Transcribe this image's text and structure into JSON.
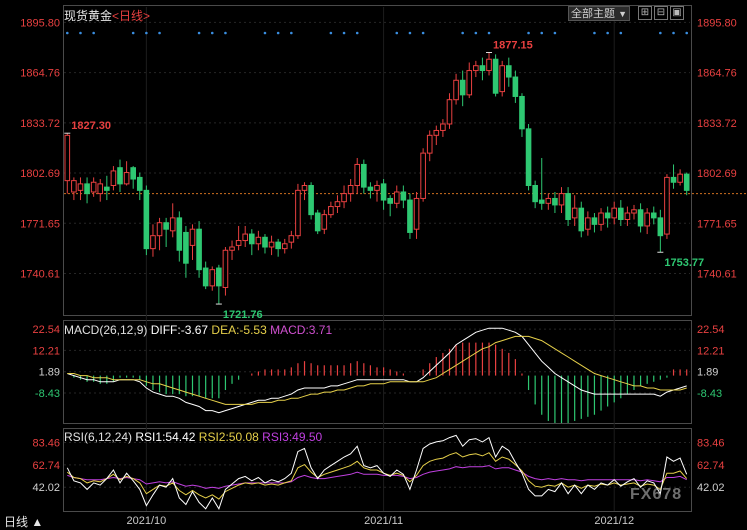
{
  "header": {
    "title": "现货黄金",
    "period": "<日线>",
    "theme_label": "全部主题",
    "dropdown_arrow": "▼"
  },
  "window_controls": [
    "square-grid-icon",
    "split-icon",
    "restore-icon"
  ],
  "footer": {
    "period_label": "日线 ▲"
  },
  "watermark": "FX678",
  "colors": {
    "up": "#e84040",
    "down": "#2ec872",
    "diff": "#ffffff",
    "dea": "#e6d04a",
    "macd": "#d050d0",
    "rsi1": "#ffffff",
    "rsi2": "#e6d04a",
    "rsi3": "#c040e0",
    "current_line": "#d07020",
    "axis_text": "#e84040",
    "axis_mid": "#d0d0d0"
  },
  "chart_data": [
    {
      "type": "candlestick",
      "title": "现货黄金 <日线>",
      "y_ticks": [
        "1895.80",
        "1864.76",
        "1833.72",
        "1802.69",
        "1771.65",
        "1740.61"
      ],
      "ylim": [
        1715,
        1896
      ],
      "x_ticks": [
        "2021/10",
        "2021/11",
        "2021/12"
      ],
      "current_price": 1790,
      "annotations": [
        {
          "label": "1827.30",
          "value": 1827.3,
          "kind": "high"
        },
        {
          "label": "1877.15",
          "value": 1877.15,
          "kind": "high"
        },
        {
          "label": "1721.76",
          "value": 1721.76,
          "kind": "low"
        },
        {
          "label": "1753.77",
          "value": 1753.77,
          "kind": "low"
        }
      ],
      "candles": [
        [
          1798,
          1826,
          1790,
          1827.3
        ],
        [
          1791,
          1798,
          1786,
          1800
        ],
        [
          1792,
          1796,
          1786,
          1800
        ],
        [
          1796,
          1790,
          1784,
          1800
        ],
        [
          1791,
          1797,
          1788,
          1800
        ],
        [
          1790,
          1796,
          1785,
          1799
        ],
        [
          1794,
          1792,
          1786,
          1801
        ],
        [
          1795,
          1804,
          1792,
          1807
        ],
        [
          1806,
          1796,
          1791,
          1811
        ],
        [
          1796,
          1803,
          1795,
          1810
        ],
        [
          1806,
          1799,
          1793,
          1807
        ],
        [
          1800,
          1792,
          1786,
          1803
        ],
        [
          1792,
          1756,
          1752,
          1795
        ],
        [
          1756,
          1764,
          1751,
          1771
        ],
        [
          1764,
          1772,
          1755,
          1775
        ],
        [
          1772,
          1768,
          1757,
          1775
        ],
        [
          1767,
          1775,
          1763,
          1784
        ],
        [
          1775,
          1755,
          1748,
          1779
        ],
        [
          1766,
          1747,
          1738,
          1770
        ],
        [
          1758,
          1768,
          1749,
          1771
        ],
        [
          1768,
          1743,
          1738,
          1773
        ],
        [
          1744,
          1733,
          1731,
          1748
        ],
        [
          1733,
          1743,
          1730,
          1745
        ],
        [
          1744,
          1733,
          1721.76,
          1746
        ],
        [
          1732,
          1755,
          1727,
          1757
        ],
        [
          1755,
          1757,
          1749,
          1761
        ],
        [
          1758,
          1761,
          1755,
          1770
        ],
        [
          1761,
          1765,
          1757,
          1770
        ],
        [
          1765,
          1759,
          1752,
          1768
        ],
        [
          1759,
          1763,
          1755,
          1767
        ],
        [
          1763,
          1757,
          1753,
          1765
        ],
        [
          1757,
          1760,
          1752,
          1764
        ],
        [
          1760,
          1756,
          1751,
          1762
        ],
        [
          1756,
          1759,
          1753,
          1762
        ],
        [
          1760,
          1764,
          1756,
          1767
        ],
        [
          1764,
          1792,
          1762,
          1796
        ],
        [
          1792,
          1795,
          1786,
          1797
        ],
        [
          1795,
          1777,
          1774,
          1797
        ],
        [
          1778,
          1767,
          1765,
          1780
        ],
        [
          1768,
          1777,
          1765,
          1780
        ],
        [
          1777,
          1782,
          1775,
          1785
        ],
        [
          1782,
          1785,
          1778,
          1789
        ],
        [
          1785,
          1790,
          1781,
          1795
        ],
        [
          1790,
          1795,
          1785,
          1799
        ],
        [
          1795,
          1808,
          1790,
          1812
        ],
        [
          1808,
          1794,
          1790,
          1811
        ],
        [
          1794,
          1792,
          1787,
          1797
        ],
        [
          1792,
          1795,
          1785,
          1798
        ],
        [
          1796,
          1786,
          1780,
          1799
        ],
        [
          1787,
          1784,
          1776,
          1789
        ],
        [
          1784,
          1791,
          1781,
          1795
        ],
        [
          1791,
          1786,
          1781,
          1795
        ],
        [
          1786,
          1766,
          1762,
          1790
        ],
        [
          1768,
          1787,
          1762,
          1791
        ],
        [
          1787,
          1815,
          1785,
          1818
        ],
        [
          1815,
          1826,
          1810,
          1829
        ],
        [
          1826,
          1829,
          1820,
          1832
        ],
        [
          1829,
          1833,
          1825,
          1836
        ],
        [
          1833,
          1848,
          1830,
          1852
        ],
        [
          1848,
          1860,
          1845,
          1864
        ],
        [
          1860,
          1851,
          1844,
          1866
        ],
        [
          1851,
          1866,
          1849,
          1871
        ],
        [
          1866,
          1869,
          1862,
          1872
        ],
        [
          1869,
          1866,
          1860,
          1874
        ],
        [
          1866,
          1873,
          1863,
          1877.15
        ],
        [
          1873,
          1852,
          1850,
          1876
        ],
        [
          1853,
          1869,
          1850,
          1872
        ],
        [
          1869,
          1862,
          1856,
          1874
        ],
        [
          1862,
          1850,
          1846,
          1866
        ],
        [
          1850,
          1830,
          1825,
          1852
        ],
        [
          1830,
          1795,
          1792,
          1833
        ],
        [
          1795,
          1785,
          1781,
          1798
        ],
        [
          1786,
          1784,
          1780,
          1812
        ],
        [
          1784,
          1787,
          1780,
          1790
        ],
        [
          1787,
          1783,
          1778,
          1791
        ],
        [
          1783,
          1790,
          1778,
          1794
        ],
        [
          1790,
          1774,
          1770,
          1794
        ],
        [
          1775,
          1781,
          1770,
          1789
        ],
        [
          1781,
          1767,
          1763,
          1785
        ],
        [
          1768,
          1775,
          1764,
          1779
        ],
        [
          1775,
          1771,
          1766,
          1778
        ],
        [
          1771,
          1778,
          1767,
          1781
        ],
        [
          1778,
          1775,
          1769,
          1782
        ],
        [
          1775,
          1781,
          1771,
          1785
        ],
        [
          1781,
          1774,
          1770,
          1786
        ],
        [
          1774,
          1778,
          1770,
          1782
        ],
        [
          1778,
          1780,
          1774,
          1783
        ],
        [
          1780,
          1770,
          1766,
          1784
        ],
        [
          1770,
          1778,
          1765,
          1781
        ],
        [
          1778,
          1775,
          1771,
          1782
        ],
        [
          1775,
          1764,
          1753.77,
          1780
        ],
        [
          1765,
          1800,
          1762,
          1802
        ],
        [
          1800,
          1797,
          1793,
          1808
        ],
        [
          1797,
          1802,
          1795,
          1805
        ],
        [
          1802,
          1792,
          1789,
          1803
        ]
      ]
    },
    {
      "type": "bar+line",
      "title": "MACD(26,12,9)",
      "indicator_labels": {
        "name": "MACD(26,12,9)",
        "diff": "DIFF:-3.67",
        "dea": "DEA:-5.53",
        "macd": "MACD:3.71"
      },
      "y_ticks": [
        "22.54",
        "12.21",
        "1.89",
        "-8.43"
      ],
      "ylim": [
        -23,
        26
      ],
      "series": [
        {
          "name": "DIFF",
          "values": [
            1,
            0,
            -1,
            -2,
            -2,
            -3,
            -3,
            -3,
            -2,
            -2,
            -2,
            -3,
            -6,
            -8,
            -9,
            -10,
            -10,
            -11,
            -13,
            -14,
            -15,
            -17,
            -17,
            -18,
            -17,
            -16,
            -15,
            -14,
            -13,
            -12,
            -12,
            -11,
            -11,
            -10,
            -9,
            -7,
            -6,
            -6,
            -6,
            -6,
            -5,
            -5,
            -4,
            -3,
            -2,
            -2,
            -2,
            -2,
            -2,
            -2,
            -2,
            -2,
            -3,
            -3,
            -1,
            2,
            5,
            8,
            11,
            15,
            17,
            19,
            21,
            22,
            23,
            23,
            23,
            22,
            21,
            19,
            15,
            11,
            7,
            4,
            1,
            -1,
            -3,
            -5,
            -7,
            -8,
            -9,
            -9,
            -9,
            -9,
            -9,
            -9,
            -9,
            -9,
            -9,
            -9,
            -10,
            -8,
            -7,
            -6,
            -5
          ]
        },
        {
          "name": "DEA",
          "values": [
            1,
            1,
            0,
            0,
            -1,
            -1,
            -1,
            -2,
            -2,
            -2,
            -2,
            -2,
            -3,
            -4,
            -4,
            -5,
            -6,
            -7,
            -8,
            -9,
            -10,
            -11,
            -12,
            -13,
            -14,
            -14,
            -14,
            -14,
            -14,
            -13,
            -13,
            -13,
            -12,
            -12,
            -11,
            -11,
            -10,
            -9,
            -9,
            -8,
            -8,
            -7,
            -7,
            -6,
            -5,
            -5,
            -4,
            -4,
            -4,
            -3,
            -3,
            -3,
            -3,
            -3,
            -3,
            -2,
            -1,
            1,
            3,
            5,
            7,
            9,
            11,
            13,
            14,
            16,
            17,
            18,
            19,
            19,
            19,
            18,
            17,
            15,
            13,
            11,
            9,
            7,
            5,
            3,
            1,
            0,
            -1,
            -2,
            -3,
            -4,
            -5,
            -5,
            -6,
            -6,
            -7,
            -7,
            -7,
            -7,
            -6
          ]
        },
        {
          "name": "MACD",
          "values": [
            0,
            -1,
            -2,
            -3,
            -3,
            -4,
            -4,
            -3,
            -1,
            -1,
            -1,
            -2,
            -5,
            -7,
            -8,
            -9,
            -9,
            -9,
            -10,
            -10,
            -10,
            -11,
            -11,
            -11,
            -7,
            -4,
            -2,
            0,
            1,
            2,
            3,
            3,
            3,
            3,
            4,
            6,
            7,
            6,
            5,
            5,
            5,
            5,
            5,
            6,
            7,
            6,
            5,
            4,
            4,
            3,
            2,
            1,
            0,
            0,
            3,
            6,
            9,
            11,
            13,
            15,
            16,
            16,
            16,
            16,
            16,
            15,
            13,
            11,
            8,
            1,
            -7,
            -14,
            -19,
            -22,
            -23,
            -23,
            -23,
            -22,
            -21,
            -20,
            -19,
            -17,
            -15,
            -13,
            -11,
            -9,
            -7,
            -5,
            -4,
            -3,
            -2,
            -1,
            3,
            3,
            3
          ]
        }
      ]
    },
    {
      "type": "line",
      "title": "RSI(6,12,24)",
      "indicator_labels": {
        "name": "RSI(6,12,24)",
        "rsi1": "RSI1:54.42",
        "rsi2": "RSI2:50.08",
        "rsi3": "RSI3:49.50"
      },
      "y_ticks": [
        "83.46",
        "62.74",
        "42.02"
      ],
      "ylim": [
        20,
        95
      ],
      "series": [
        {
          "name": "RSI1",
          "values": [
            60,
            48,
            46,
            40,
            46,
            44,
            50,
            58,
            46,
            55,
            48,
            40,
            25,
            35,
            44,
            42,
            50,
            32,
            26,
            38,
            28,
            22,
            32,
            22,
            40,
            45,
            50,
            52,
            48,
            51,
            46,
            49,
            47,
            50,
            55,
            75,
            78,
            60,
            50,
            58,
            62,
            66,
            70,
            73,
            80,
            62,
            60,
            62,
            55,
            52,
            58,
            54,
            40,
            58,
            78,
            82,
            84,
            85,
            88,
            90,
            80,
            86,
            87,
            84,
            88,
            70,
            80,
            76,
            65,
            55,
            40,
            34,
            34,
            40,
            38,
            46,
            36,
            44,
            36,
            44,
            40,
            46,
            44,
            49,
            43,
            47,
            50,
            42,
            48,
            46,
            36,
            70,
            66,
            69,
            54
          ]
        },
        {
          "name": "RSI2",
          "values": [
            56,
            51,
            50,
            46,
            48,
            47,
            50,
            54,
            49,
            52,
            50,
            46,
            36,
            40,
            44,
            43,
            46,
            39,
            35,
            39,
            35,
            32,
            35,
            31,
            38,
            41,
            44,
            46,
            45,
            46,
            44,
            45,
            44,
            46,
            48,
            60,
            63,
            56,
            51,
            54,
            56,
            58,
            60,
            62,
            66,
            60,
            58,
            58,
            55,
            53,
            55,
            53,
            47,
            53,
            62,
            66,
            68,
            69,
            72,
            74,
            70,
            72,
            73,
            71,
            74,
            66,
            70,
            68,
            63,
            57,
            48,
            43,
            42,
            44,
            43,
            46,
            42,
            44,
            41,
            44,
            43,
            45,
            44,
            46,
            44,
            45,
            46,
            43,
            45,
            44,
            40,
            55,
            55,
            57,
            50
          ]
        },
        {
          "name": "RSI3",
          "values": [
            53,
            51,
            50,
            49,
            49,
            49,
            50,
            51,
            50,
            51,
            50,
            49,
            45,
            46,
            47,
            46,
            47,
            45,
            43,
            44,
            43,
            41,
            42,
            41,
            43,
            44,
            45,
            46,
            46,
            46,
            46,
            46,
            46,
            46,
            47,
            51,
            53,
            51,
            50,
            50,
            51,
            52,
            53,
            54,
            56,
            54,
            54,
            54,
            53,
            53,
            53,
            52,
            50,
            51,
            54,
            56,
            57,
            58,
            59,
            61,
            60,
            61,
            61,
            61,
            62,
            59,
            60,
            60,
            58,
            56,
            52,
            50,
            49,
            50,
            49,
            50,
            49,
            49,
            48,
            49,
            49,
            49,
            49,
            49,
            49,
            49,
            49,
            48,
            49,
            48,
            47,
            51,
            51,
            52,
            49
          ]
        }
      ]
    }
  ]
}
